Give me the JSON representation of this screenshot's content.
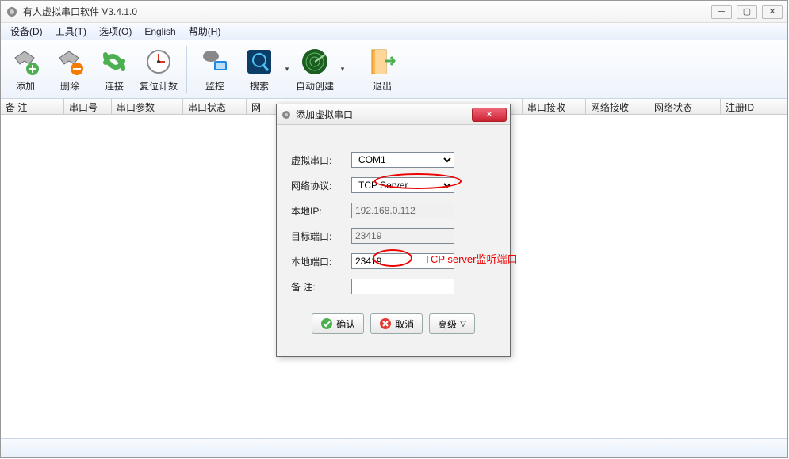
{
  "window": {
    "title": "有人虚拟串口软件 V3.4.1.0"
  },
  "menu": {
    "items": [
      "设备(D)",
      "工具(T)",
      "选项(O)",
      "English",
      "帮助(H)"
    ]
  },
  "toolbar": {
    "add": "添加",
    "delete": "删除",
    "connect": "连接",
    "resetcount": "复位计数",
    "monitor": "监控",
    "search": "搜索",
    "autocreate": "自动创建",
    "exit": "退出"
  },
  "columns": [
    "备 注",
    "串口号",
    "串口参数",
    "串口状态",
    "网",
    "串口接收",
    "网络接收",
    "网络状态",
    "注册ID"
  ],
  "dialog": {
    "title": "添加虚拟串口",
    "fields": {
      "vcom_label": "虚拟串口:",
      "vcom_value": "COM1",
      "proto_label": "网络协议:",
      "proto_value": "TCP Server",
      "localip_label": "本地IP:",
      "localip_value": "192.168.0.112",
      "targetport_label": "目标端口:",
      "targetport_value": "23419",
      "localport_label": "本地端口:",
      "localport_value": "23419",
      "remark_label": "备 注:",
      "remark_value": ""
    },
    "buttons": {
      "ok": "确认",
      "cancel": "取消",
      "advanced": "高级"
    }
  },
  "annotation": {
    "text": "TCP server监听端口"
  }
}
